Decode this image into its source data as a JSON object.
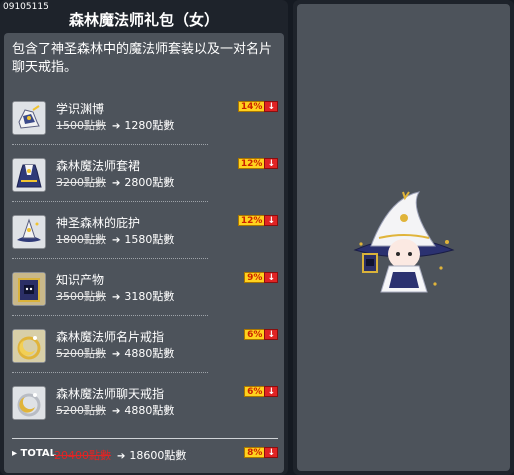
{
  "package": {
    "id": "09105115",
    "title": "森林魔法师礼包（女）",
    "description": "包含了神圣森林中的魔法师套装以及一对名片聊天戒指。"
  },
  "items": [
    {
      "name": "学识渊博",
      "old_price": "1500點數",
      "new_price": "1280點數",
      "discount": "14%",
      "icon": "boots-icon"
    },
    {
      "name": "森林魔法师套裙",
      "old_price": "3200點數",
      "new_price": "2800點數",
      "discount": "12%",
      "icon": "robe-icon"
    },
    {
      "name": "神圣森林的庇护",
      "old_price": "1800點數",
      "new_price": "1580點數",
      "discount": "12%",
      "icon": "hat-icon"
    },
    {
      "name": "知识产物",
      "old_price": "3500點數",
      "new_price": "3180點數",
      "discount": "9%",
      "icon": "spellbook-icon"
    },
    {
      "name": "森林魔法师名片戒指",
      "old_price": "5200點數",
      "new_price": "4880點數",
      "discount": "6%",
      "icon": "moon-ring-icon"
    },
    {
      "name": "森林魔法师聊天戒指",
      "old_price": "5200點數",
      "new_price": "4880點數",
      "discount": "6%",
      "icon": "moon-ring-icon"
    }
  ],
  "total": {
    "label": "TOTAL",
    "old_price": "20400點數",
    "new_price": "18600點數",
    "discount": "8%"
  },
  "colors": {
    "panel_bg": "#1e232b",
    "content_bg": "#4d535b",
    "badge_yellow": "#ffd21e",
    "badge_red": "#e02424",
    "total_old_price": "#e22424"
  },
  "preview": {
    "icon": "forest-mage-character-icon"
  }
}
